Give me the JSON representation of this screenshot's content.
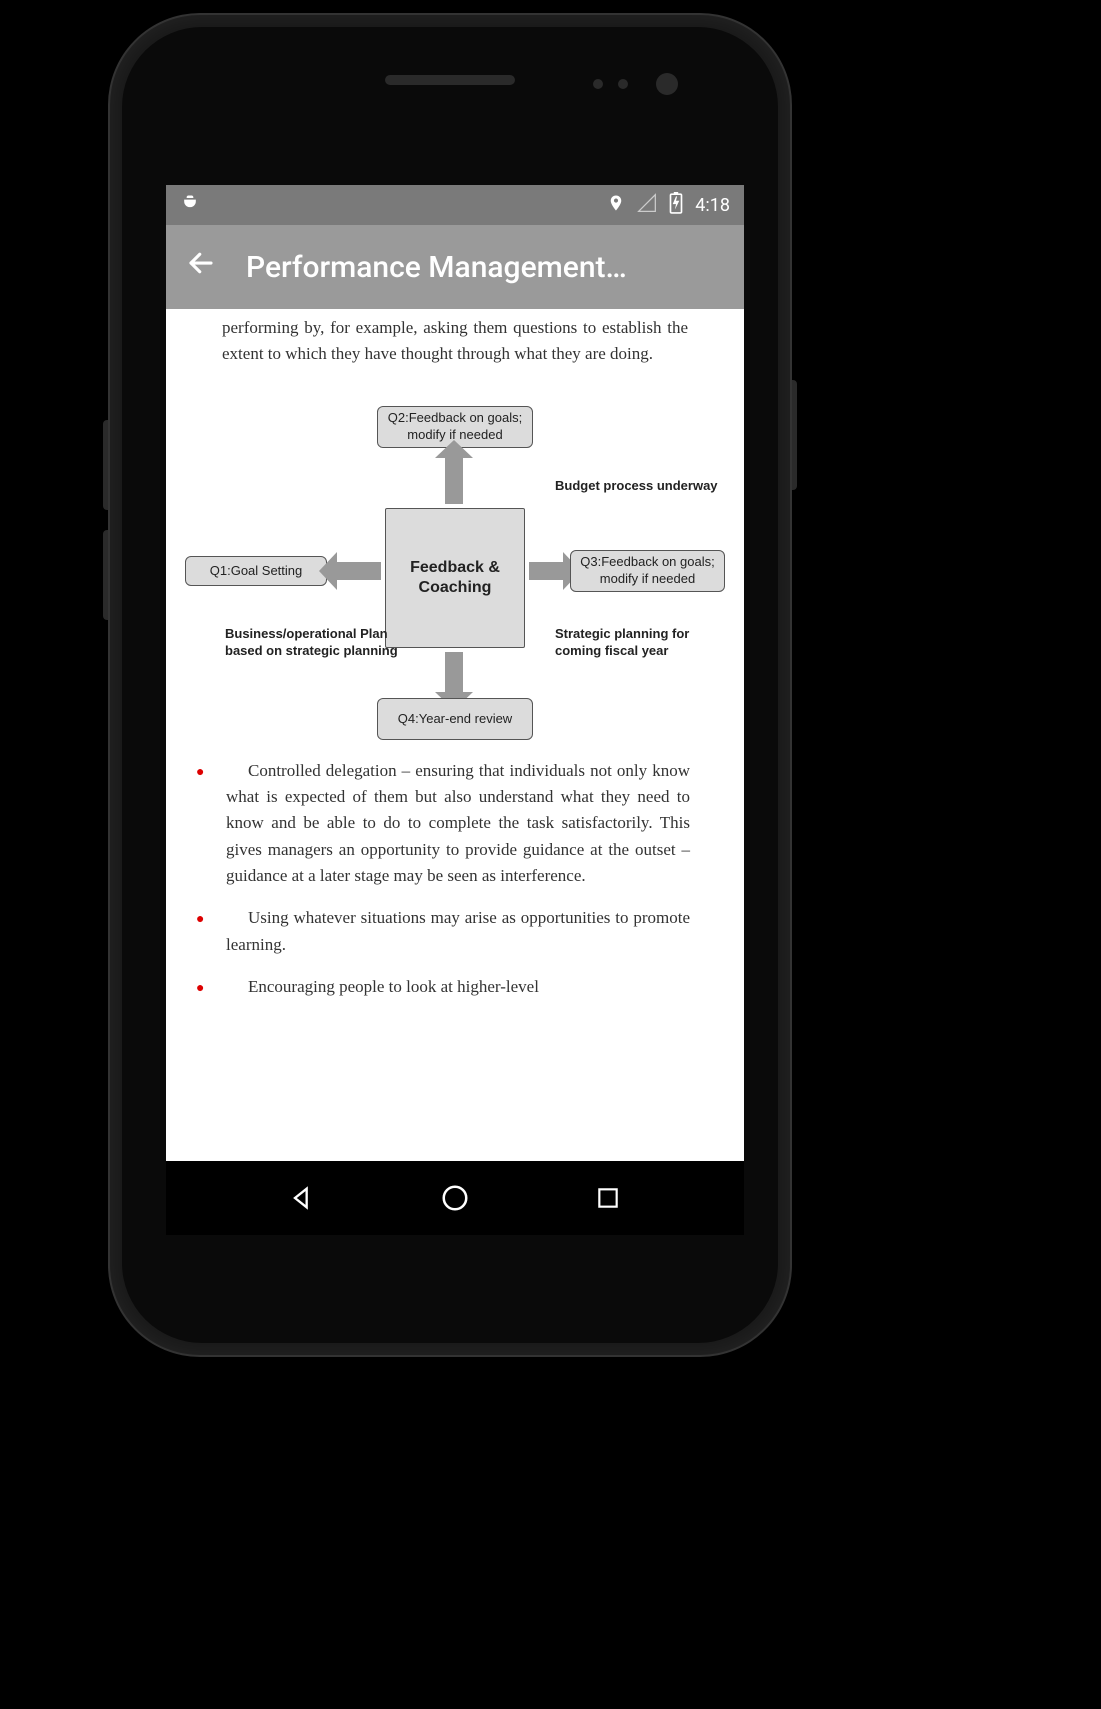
{
  "statusBar": {
    "time": "4:18"
  },
  "appBar": {
    "title": "Performance Management…"
  },
  "content": {
    "introPara": "performing by, for example, asking them questions to establish the extent to which they have thought through what they are doing."
  },
  "diagram": {
    "center": "Feedback & Coaching",
    "top": "Q2:Feedback on goals; modify if needed",
    "bottom": "Q4:Year-end review",
    "left": "Q1:Goal Setting",
    "right": "Q3:Feedback on goals; modify if needed",
    "annotTopRight": "Budget process underway",
    "annotBottomLeft": "Business/operational Plan based on strategic planning",
    "annotBottomRight": "Strategic planning for coming fiscal year"
  },
  "bullets": [
    "Controlled delegation – ensuring that individuals not only know what is expected of them but also understand what they need to know and be able to do to complete the task satisfactorily. This gives managers an opportunity to provide guidance at the outset – guidance at a later stage may be seen as interference.",
    "Using whatever situations may arise as opportunities to promote learning.",
    "Encouraging people to look at higher-level"
  ]
}
